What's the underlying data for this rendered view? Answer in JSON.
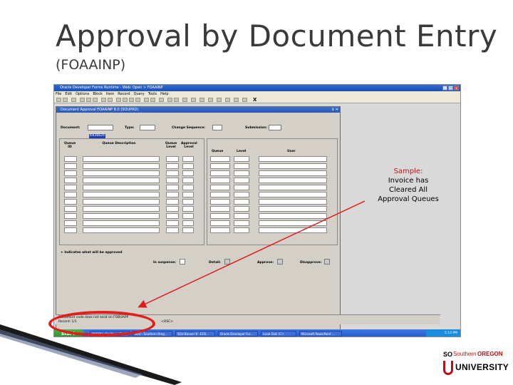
{
  "slide": {
    "title": "Approval by Document Entry",
    "subtitle": "(FOAAINP)"
  },
  "window": {
    "title": "Oracle Developer Forms Runtime - Web:  Open > FOAAINP",
    "min": "_",
    "max": "□",
    "close": "x"
  },
  "menu": [
    "File",
    "Edit",
    "Options",
    "Block",
    "Item",
    "Record",
    "Query",
    "Tools",
    "Help"
  ],
  "toolbar": {
    "close_label": "X"
  },
  "form": {
    "title": "Document Approval  FOAAINP  8.0  (SOUPRD)",
    "controls": "⊻ ✕",
    "document_label": "Document:",
    "document_value": "I0436629",
    "type_label": "Type:",
    "change_seq_label": "Change Sequence:",
    "submission_label": "Submission:",
    "left_headers": {
      "queue_id": "Queue ID",
      "queue_desc": "Queue Description",
      "queue_level": "Queue Level",
      "approval_level": "Approval Level"
    },
    "right_headers": {
      "queue": "Queue",
      "level": "Level",
      "user": "User"
    },
    "legend": "+ Indicates what will be approved",
    "in_suspense": "In suspense:",
    "detail": "Detail:",
    "approve": "Approve:",
    "disapprove": "Disapprove:"
  },
  "status": {
    "message": "Document code does not exist on FOBUAPP",
    "record": "Record: 1/1",
    "osc": "<OSC>"
  },
  "taskbar": {
    "start": "start",
    "tasks": [
      "MUSOU - Southern Or...",
      "SOU - Southern Oreg...",
      "SOU Banner 8 - ECR...",
      "Oracle Developer For...",
      "Local Disk (C:)",
      "Microsoft PowerPoint ..."
    ],
    "clock": "5:10 PM"
  },
  "annotation": {
    "heading": "Sample:",
    "line1": "Invoice has",
    "line2": "Cleared All",
    "line3": "Approval Queues"
  },
  "logo": {
    "so": "SO",
    "southern": "Southern",
    "oregon": "OREGON",
    "university": "UNIVERSITY"
  },
  "colors": {
    "accent_red": "#e01e1e",
    "brand_red": "#b5121b",
    "titlebar_blue": "#2456c6"
  }
}
